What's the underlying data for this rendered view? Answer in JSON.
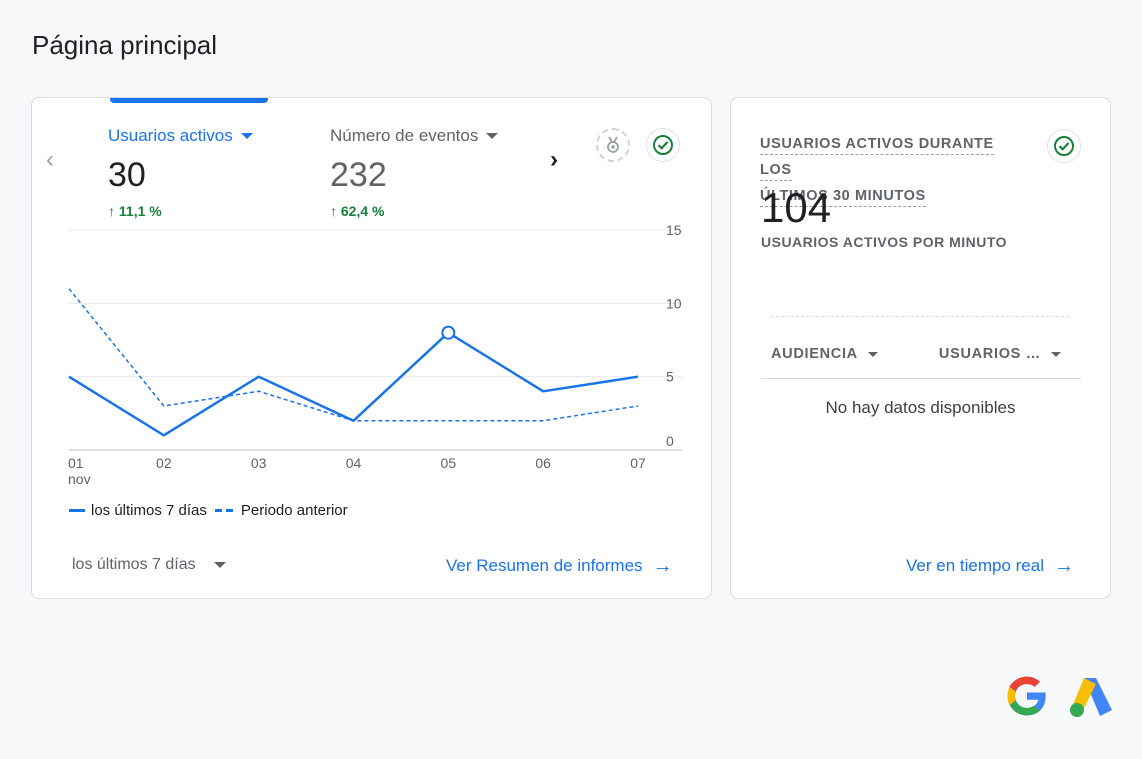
{
  "page": {
    "title": "Página principal"
  },
  "overview": {
    "metrics": [
      {
        "label": "Usuarios activos",
        "value": "30",
        "change": "11,1 %"
      },
      {
        "label": "Número de eventos",
        "value": "232",
        "change": "62,4 %"
      }
    ],
    "legend": {
      "current": "los últimos 7 días",
      "previous": "Periodo anterior"
    },
    "date_range": "los últimos 7 días",
    "report_link": "Ver Resumen de informes"
  },
  "chart_data": {
    "type": "line",
    "x": [
      "01",
      "02",
      "03",
      "04",
      "05",
      "06",
      "07"
    ],
    "x_sublabel_first": "nov",
    "y_ticks": [
      "15",
      "10",
      "5",
      "0"
    ],
    "ylim": [
      0,
      15
    ],
    "grid": true,
    "series": [
      {
        "name": "los últimos 7 días",
        "style": "solid",
        "values": [
          5,
          1,
          5,
          2,
          8,
          4,
          5
        ]
      },
      {
        "name": "Periodo anterior",
        "style": "dashed",
        "values": [
          11,
          3,
          4,
          2,
          2,
          2,
          3
        ]
      }
    ],
    "highlight_index": 4,
    "color": "#1a73e8"
  },
  "realtime": {
    "title_line1": "USUARIOS ACTIVOS DURANTE LOS",
    "title_line2": "ÚLTIMOS 30 MINUTOS",
    "value": "104",
    "subtitle": "USUARIOS ACTIVOS POR MINUTO",
    "col_audience": "AUDIENCIA",
    "col_users": "USUARIOS …",
    "empty_text": "No hay datos disponibles",
    "link": "Ver en tiempo real"
  },
  "icons": {
    "prev": "‹",
    "next": "›",
    "up_arrow": "↑",
    "arrow_right": "→"
  },
  "colors": {
    "accent": "#1a73e8",
    "positive": "#188038",
    "check": "#188038"
  }
}
